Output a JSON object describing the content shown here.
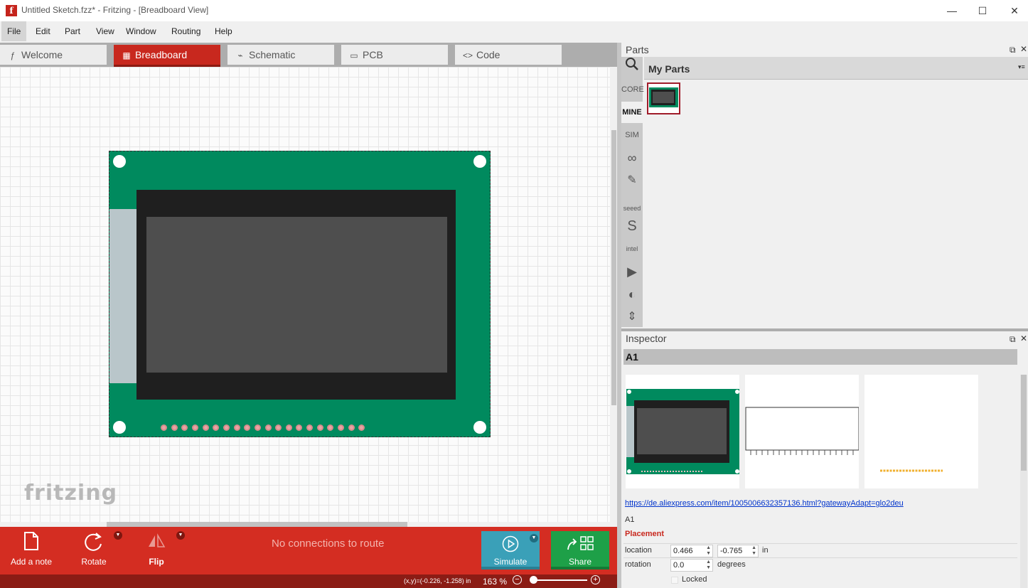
{
  "window": {
    "title": "Untitled Sketch.fzz* - Fritzing - [Breadboard View]",
    "logo_letter": "f",
    "minimize": "—",
    "maximize": "☐",
    "close": "✕"
  },
  "menu": [
    "File",
    "Edit",
    "Part",
    "View",
    "Window",
    "Routing",
    "Help"
  ],
  "tabs": [
    {
      "label": "Welcome",
      "icon": "ƒ"
    },
    {
      "label": "Breadboard",
      "icon": "▦"
    },
    {
      "label": "Schematic",
      "icon": "⌁"
    },
    {
      "label": "PCB",
      "icon": "▭"
    },
    {
      "label": "Code",
      "icon": "<>"
    }
  ],
  "canvas": {
    "watermark": "fritzing",
    "header_pin_count": 20
  },
  "toolbar": {
    "add_note": "Add a note",
    "rotate": "Rotate",
    "flip": "Flip",
    "routing_status": "No connections to route",
    "simulate": "Simulate",
    "share": "Share"
  },
  "status": {
    "coords": "(x,y)=(-0.226, -1.258) in",
    "zoom": "163 %"
  },
  "parts": {
    "title": "Parts",
    "bin_title": "My Parts",
    "bins": [
      "CORE",
      "MINE",
      "SIM",
      "∞",
      "✎",
      "seeed",
      "S",
      "intel",
      "▶",
      "◐",
      "⇕"
    ]
  },
  "inspector": {
    "title": "Inspector",
    "part_name": "A1",
    "url": "https://de.aliexpress.com/item/1005006632357136.html?gatewayAdapt=glo2deu",
    "label": "A1",
    "placement_header": "Placement",
    "location_label": "location",
    "location_x": "0.466",
    "location_y": "-0.765",
    "location_unit": "in",
    "rotation_label": "rotation",
    "rotation_value": "0.0",
    "rotation_unit": "degrees",
    "locked_label": "Locked"
  }
}
